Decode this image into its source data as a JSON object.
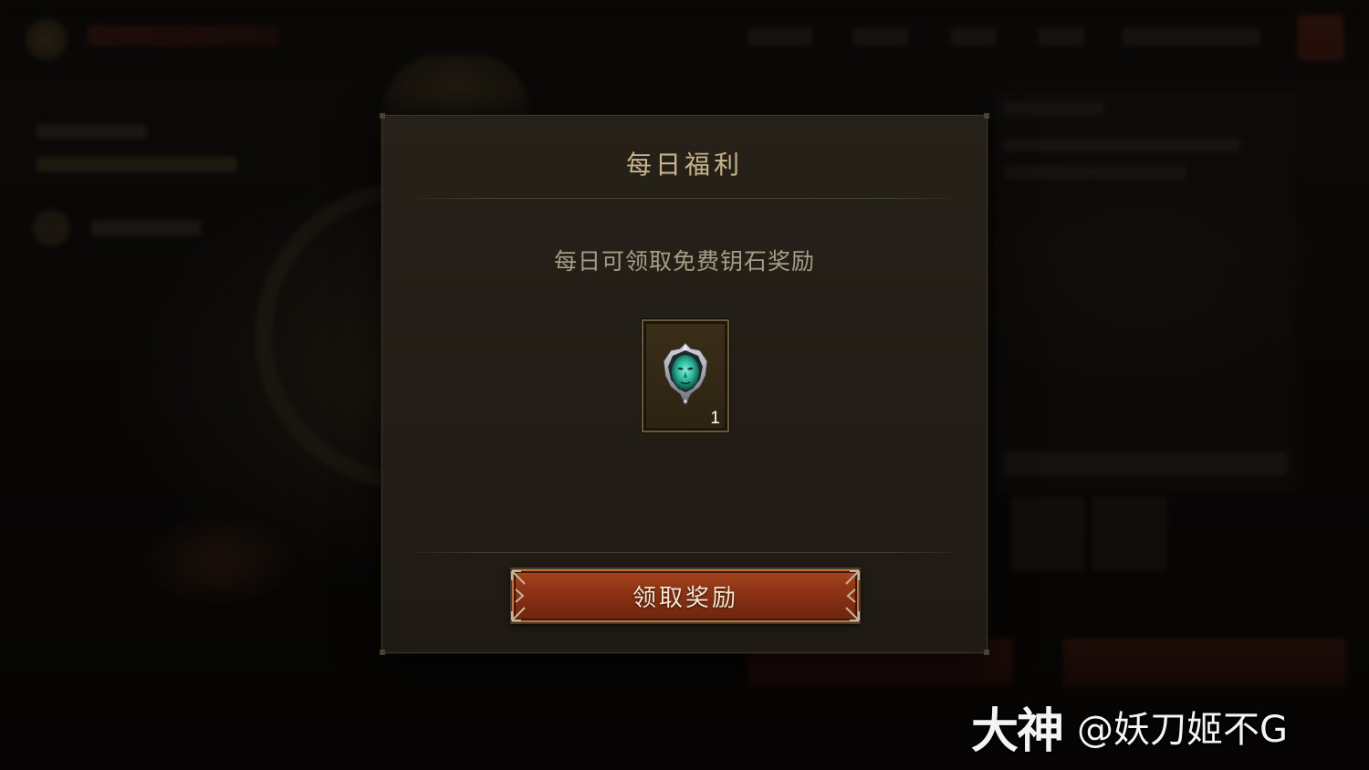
{
  "dialog": {
    "title": "每日福利",
    "description": "每日可领取免费钥石奖励",
    "reward": {
      "icon": "keystone-icon",
      "count": "1"
    },
    "claim_button_label": "领取奖励"
  },
  "watermark": {
    "logo": "大神",
    "user": "@妖刀姬不G"
  },
  "colors": {
    "title": "#c8b48a",
    "description": "#a79c86",
    "button": "#8a3215",
    "dialog_bg": "#231e17"
  }
}
